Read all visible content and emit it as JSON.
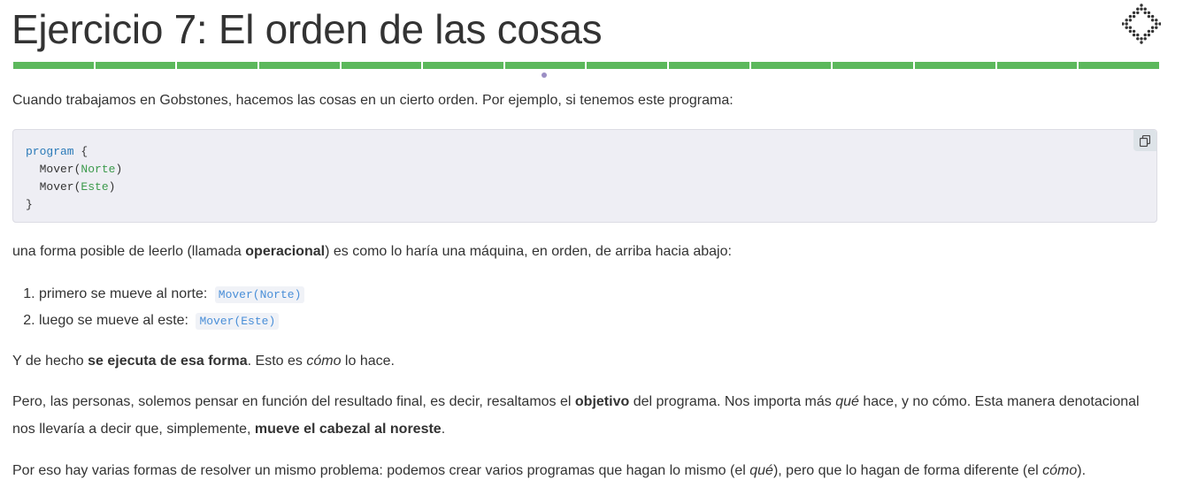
{
  "title": "Ejercicio 7: El orden de las cosas",
  "progress": {
    "segments": 14,
    "current_index": 6,
    "completed_color": "#5cb85c",
    "current_marker_color": "#9b8ec4"
  },
  "intro": "Cuando trabajamos en Gobstones, hacemos las cosas en un cierto orden. Por ejemplo, si tenemos este programa:",
  "code": {
    "keyword": "program",
    "line1_rest": " {",
    "line2_call": "  Mover(",
    "line2_arg": "Norte",
    "line2_end": ")",
    "line3_call": "  Mover(",
    "line3_arg": "Este",
    "line3_end": ")",
    "line4": "}",
    "copy_icon": "copy-icon"
  },
  "para1": {
    "before": "una forma posible de leerlo (llamada ",
    "bold": "operacional",
    "after": ") es como lo haría una máquina, en orden, de arriba hacia abajo:"
  },
  "steps": [
    {
      "text": "primero se mueve al norte:",
      "code": "Mover(Norte)"
    },
    {
      "text": "luego se mueve al este:",
      "code": "Mover(Este)"
    }
  ],
  "para2": {
    "before": "Y de hecho ",
    "bold": "se ejecuta de esa forma",
    "middle": ". Esto es ",
    "italic": "cómo",
    "after": " lo hace."
  },
  "para3": {
    "p1": "Pero, las personas, solemos pensar en función del resultado final, es decir, resaltamos el ",
    "b1": "objetivo",
    "p2": " del programa. Nos importa más ",
    "i1": "qué",
    "p3": " hace, y no cómo. Esta manera denotacional nos llevaría a decir que, simplemente, ",
    "b2": "mueve el cabezal al noreste",
    "p4": "."
  },
  "para4": {
    "p1": "Por eso hay varias formas de resolver un mismo problema: podemos crear varios programas que hagan lo mismo (el ",
    "i1": "qué",
    "p2": "), pero que lo hagan de forma diferente (el ",
    "i2": "cómo",
    "p3": ")."
  }
}
